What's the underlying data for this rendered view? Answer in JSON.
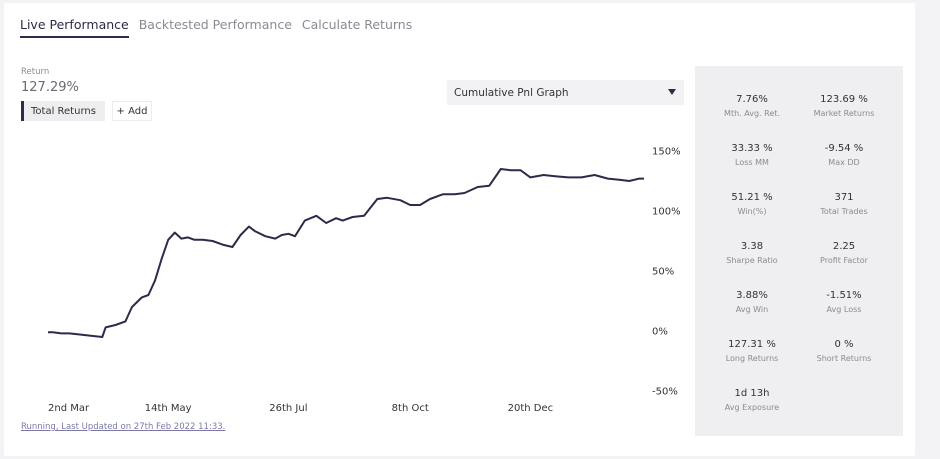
{
  "tabs": [
    {
      "label": "Live Performance",
      "active": true
    },
    {
      "label": "Backtested Performance",
      "active": false
    },
    {
      "label": "Calculate Returns",
      "active": false
    }
  ],
  "summary": {
    "return_label": "Return",
    "return_value": "127.29%"
  },
  "series_buttons": {
    "total_returns": "Total Returns",
    "add": "+ Add"
  },
  "graph_select": {
    "value": "Cumulative Pnl Graph"
  },
  "chart_data": {
    "type": "line",
    "title": "",
    "xlabel": "",
    "ylabel": "",
    "x_ticks": [
      "2nd Mar",
      "14th May",
      "26th Jul",
      "8th Oct",
      "20th Dec"
    ],
    "y_ticks": [
      "150%",
      "100%",
      "50%",
      "0%",
      "-50%"
    ],
    "ylim": [
      -50,
      150
    ],
    "grid": false,
    "color": "#2d2a4a",
    "series": [
      {
        "name": "",
        "x": [
          "2021-03-02",
          "2021-03-05",
          "2021-03-10",
          "2021-03-15",
          "2021-03-22",
          "2021-03-28",
          "2021-04-04",
          "2021-04-06",
          "2021-04-12",
          "2021-04-18",
          "2021-04-22",
          "2021-04-28",
          "2021-05-02",
          "2021-05-06",
          "2021-05-10",
          "2021-05-14",
          "2021-05-18",
          "2021-05-22",
          "2021-05-26",
          "2021-05-30",
          "2021-06-04",
          "2021-06-10",
          "2021-06-16",
          "2021-06-22",
          "2021-06-27",
          "2021-07-02",
          "2021-07-06",
          "2021-07-12",
          "2021-07-18",
          "2021-07-22",
          "2021-07-26",
          "2021-07-30",
          "2021-08-05",
          "2021-08-12",
          "2021-08-18",
          "2021-08-24",
          "2021-08-28",
          "2021-09-03",
          "2021-09-10",
          "2021-09-18",
          "2021-09-24",
          "2021-10-02",
          "2021-10-08",
          "2021-10-14",
          "2021-10-20",
          "2021-10-28",
          "2021-11-04",
          "2021-11-10",
          "2021-11-18",
          "2021-11-25",
          "2021-12-02",
          "2021-12-08",
          "2021-12-14",
          "2021-12-20",
          "2021-12-28",
          "2022-01-04",
          "2022-01-12",
          "2022-01-20",
          "2022-01-28",
          "2022-02-05",
          "2022-02-12",
          "2022-02-18",
          "2022-02-24",
          "2022-02-27"
        ],
        "values": [
          -1,
          -1,
          -2,
          -2,
          -3,
          -4,
          -5,
          3,
          5,
          8,
          20,
          28,
          30,
          42,
          60,
          76,
          82,
          77,
          78,
          76,
          76,
          75,
          72,
          70,
          80,
          87,
          83,
          79,
          77,
          80,
          81,
          79,
          92,
          96,
          90,
          94,
          92,
          95,
          96,
          110,
          111,
          109,
          105,
          105,
          110,
          114,
          114,
          115,
          120,
          121,
          135,
          134,
          134,
          128,
          130,
          129,
          128,
          128,
          130,
          127,
          126,
          125,
          127,
          127
        ]
      }
    ]
  },
  "footer": {
    "status": "Running, Last Updated on 27th Feb 2022 11:33."
  },
  "stats": [
    {
      "value": "7.76%",
      "label": "Mth. Avg. Ret."
    },
    {
      "value": "123.69 %",
      "label": "Market Returns"
    },
    {
      "value": "33.33 %",
      "label": "Loss MM"
    },
    {
      "value": "-9.54 %",
      "label": "Max DD"
    },
    {
      "value": "51.21 %",
      "label": "Win(%)"
    },
    {
      "value": "371",
      "label": "Total Trades"
    },
    {
      "value": "3.38",
      "label": "Sharpe Ratio"
    },
    {
      "value": "2.25",
      "label": "Profit Factor"
    },
    {
      "value": "3.88%",
      "label": "Avg Win"
    },
    {
      "value": "-1.51%",
      "label": "Avg Loss"
    },
    {
      "value": "127.31 %",
      "label": "Long Returns"
    },
    {
      "value": "0 %",
      "label": "Short Returns"
    },
    {
      "value": "1d 13h",
      "label": "Avg Exposure"
    }
  ]
}
